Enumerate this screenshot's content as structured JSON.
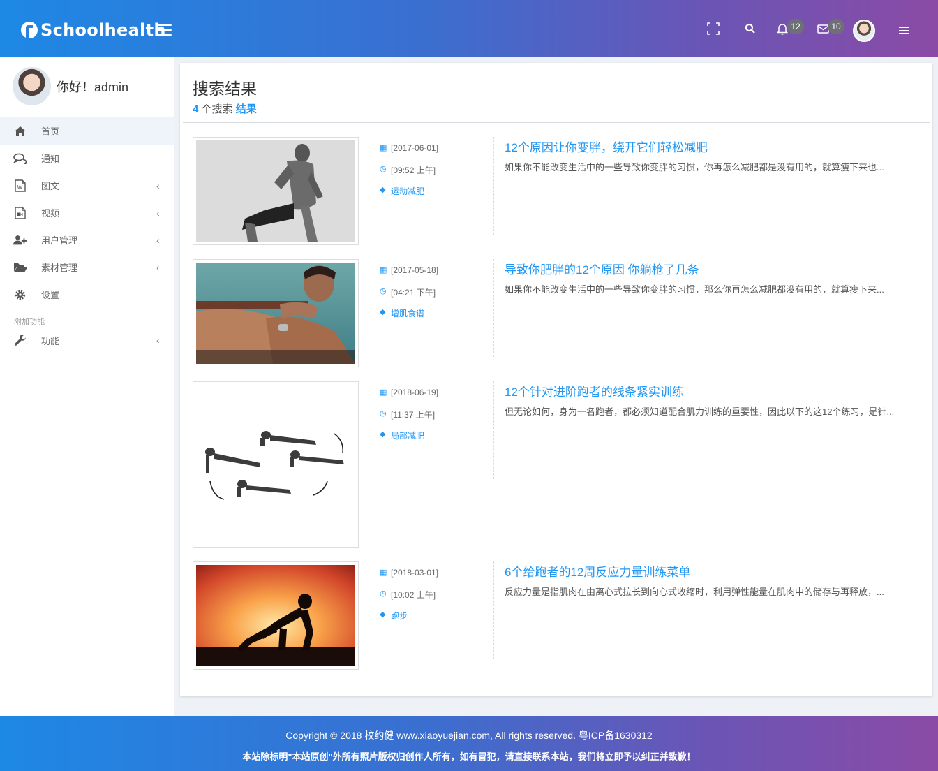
{
  "header": {
    "logo_text": "Schoolhealth",
    "notifications_count": "12",
    "messages_count": "10"
  },
  "sidebar": {
    "greeting": "你好！admin",
    "items": [
      {
        "label": "首页",
        "icon": "home-icon",
        "active": true
      },
      {
        "label": "通知",
        "icon": "comments-icon"
      },
      {
        "label": "图文",
        "icon": "word-file-icon",
        "chevron": "‹"
      },
      {
        "label": "视频",
        "icon": "video-file-icon",
        "chevron": "‹"
      },
      {
        "label": "用户管理",
        "icon": "user-plus-icon",
        "chevron": "‹"
      },
      {
        "label": "素材管理",
        "icon": "folder-open-icon",
        "chevron": "‹"
      },
      {
        "label": "设置",
        "icon": "gear-icon"
      }
    ],
    "section_header": "附加功能",
    "extra_items": [
      {
        "label": "功能",
        "icon": "wrench-icon",
        "chevron": "‹"
      }
    ]
  },
  "main": {
    "title": "搜索结果",
    "count": "4",
    "count_text": " 个搜索 ",
    "result_word": "结果",
    "results": [
      {
        "date": "[2017-06-01]",
        "time": "[09:52 上午]",
        "tag": "运动减肥",
        "title": "12个原因让你变胖，绕开它们轻松减肥",
        "desc": "如果你不能改变生活中的一些导致你变胖的习惯，你再怎么减肥都是没有用的，就算瘦下来也..."
      },
      {
        "date": "[2017-05-18]",
        "time": "[04:21 下午]",
        "tag": "增肌食谱",
        "title": "导致你肥胖的12个原因 你躺枪了几条",
        "desc": "如果你不能改变生活中的一些导致你变胖的习惯，那么你再怎么减肥都没有用的，就算瘦下来..."
      },
      {
        "date": "[2018-06-19]",
        "time": "[11:37 上午]",
        "tag": "局部减肥",
        "title": "12个针对进阶跑者的线条紧实训练",
        "desc": "但无论如何，身为一名跑者，都必须知道配合肌力训练的重要性，因此以下的这12个练习，是针..."
      },
      {
        "date": "[2018-03-01]",
        "time": "[10:02 上午]",
        "tag": "跑步",
        "title": "6个给跑者的12周反应力量训练菜单",
        "desc": "反应力量是指肌肉在由离心式拉长到向心式收缩时，利用弹性能量在肌肉中的储存与再释放，..."
      }
    ]
  },
  "footer": {
    "line1": "Copyright © 2018 校约健 www.xiaoyuejian.com, All rights reserved. 粤ICP备1630312",
    "line2": "本站除标明\"本站原创\"外所有照片版权归创作人所有，如有冒犯，请直接联系本站，我们将立即予以纠正并致歉！"
  }
}
